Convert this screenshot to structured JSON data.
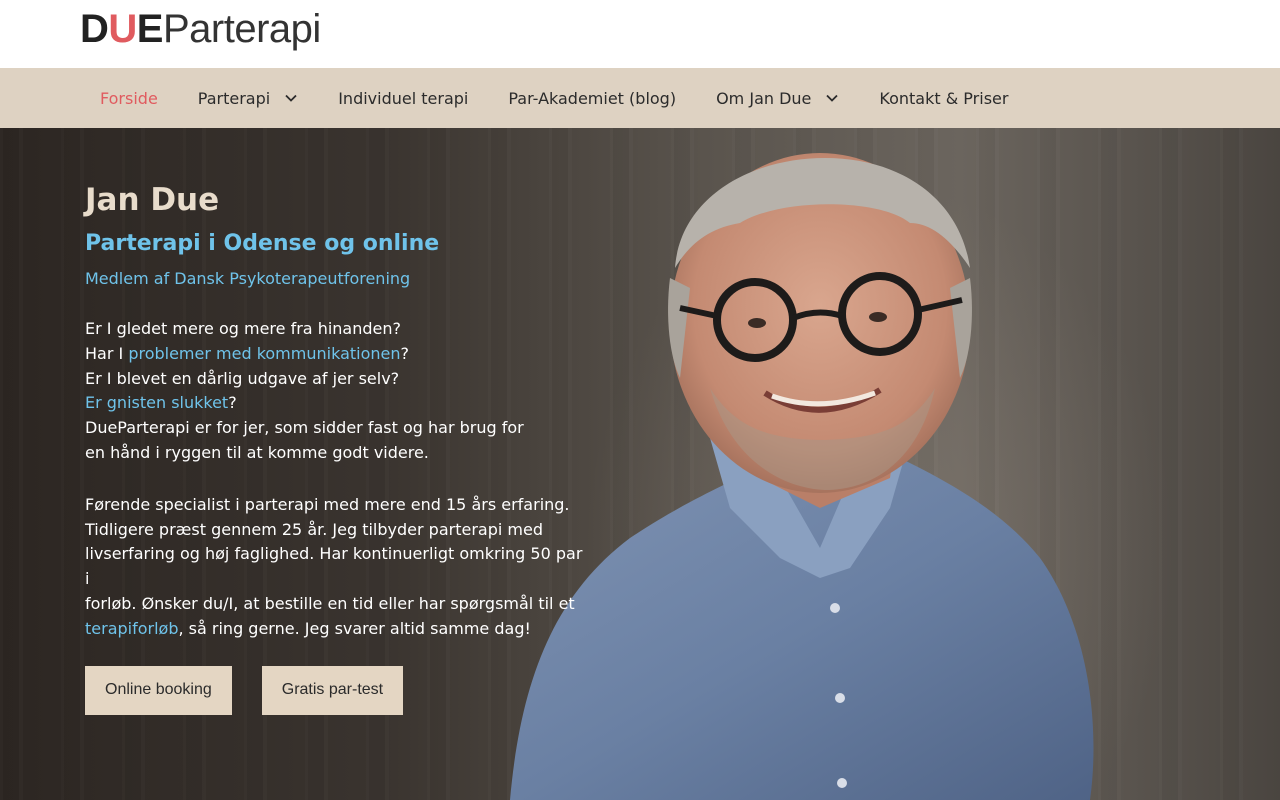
{
  "logo": {
    "part1": "D",
    "part2": "U",
    "part3": "E",
    "part4": "Parterapi"
  },
  "nav": {
    "items": [
      {
        "label": "Forside"
      },
      {
        "label": "Parterapi"
      },
      {
        "label": "Individuel terapi"
      },
      {
        "label": "Par-Akademiet (blog)"
      },
      {
        "label": "Om Jan Due"
      },
      {
        "label": "Kontakt & Priser"
      }
    ],
    "active_item": "Forside",
    "dropdown_icon": "chevron-down-icon"
  },
  "hero": {
    "title": "Jan Due",
    "subtitle": "Parterapi i Odense og online",
    "membership": "Medlem af Dansk Psykoterapeutforening",
    "lines": {
      "l1": "Er I gledet mere og mere fra hinanden?",
      "l2_pre": "Har I ",
      "l2_link": "problemer med kommunikationen",
      "l2_post": "?",
      "l3": "Er I blevet en dårlig udgave af jer selv?",
      "l4_link": "Er gnisten slukket",
      "l4_post": "?",
      "l5": "DueParterapi er for jer, som sidder fast og har brug for",
      "l6": "en hånd i ryggen til at komme godt videre."
    },
    "para2": {
      "l1": "Førende specialist i parterapi med mere end 15 års erfaring.",
      "l2": "Tidligere præst gennem 25 år. Jeg tilbyder parterapi med",
      "l3": "livserfaring og høj faglighed. Har kontinuerligt omkring 50 par i",
      "l4": "forløb. Ønsker du/I, at bestille en tid eller har spørgsmål til et",
      "l5_link": "terapiforløb",
      "l5_post": ", så ring gerne. Jeg svarer altid samme dag!"
    },
    "buttons": {
      "booking": "Online booking",
      "test": "Gratis par-test"
    }
  },
  "colors": {
    "accent_red": "#e05b5f",
    "link_blue": "#6fc3ea",
    "nav_bg": "#ded2c2",
    "button_bg": "#e4d6c3",
    "title_beige": "#e8dccb"
  }
}
